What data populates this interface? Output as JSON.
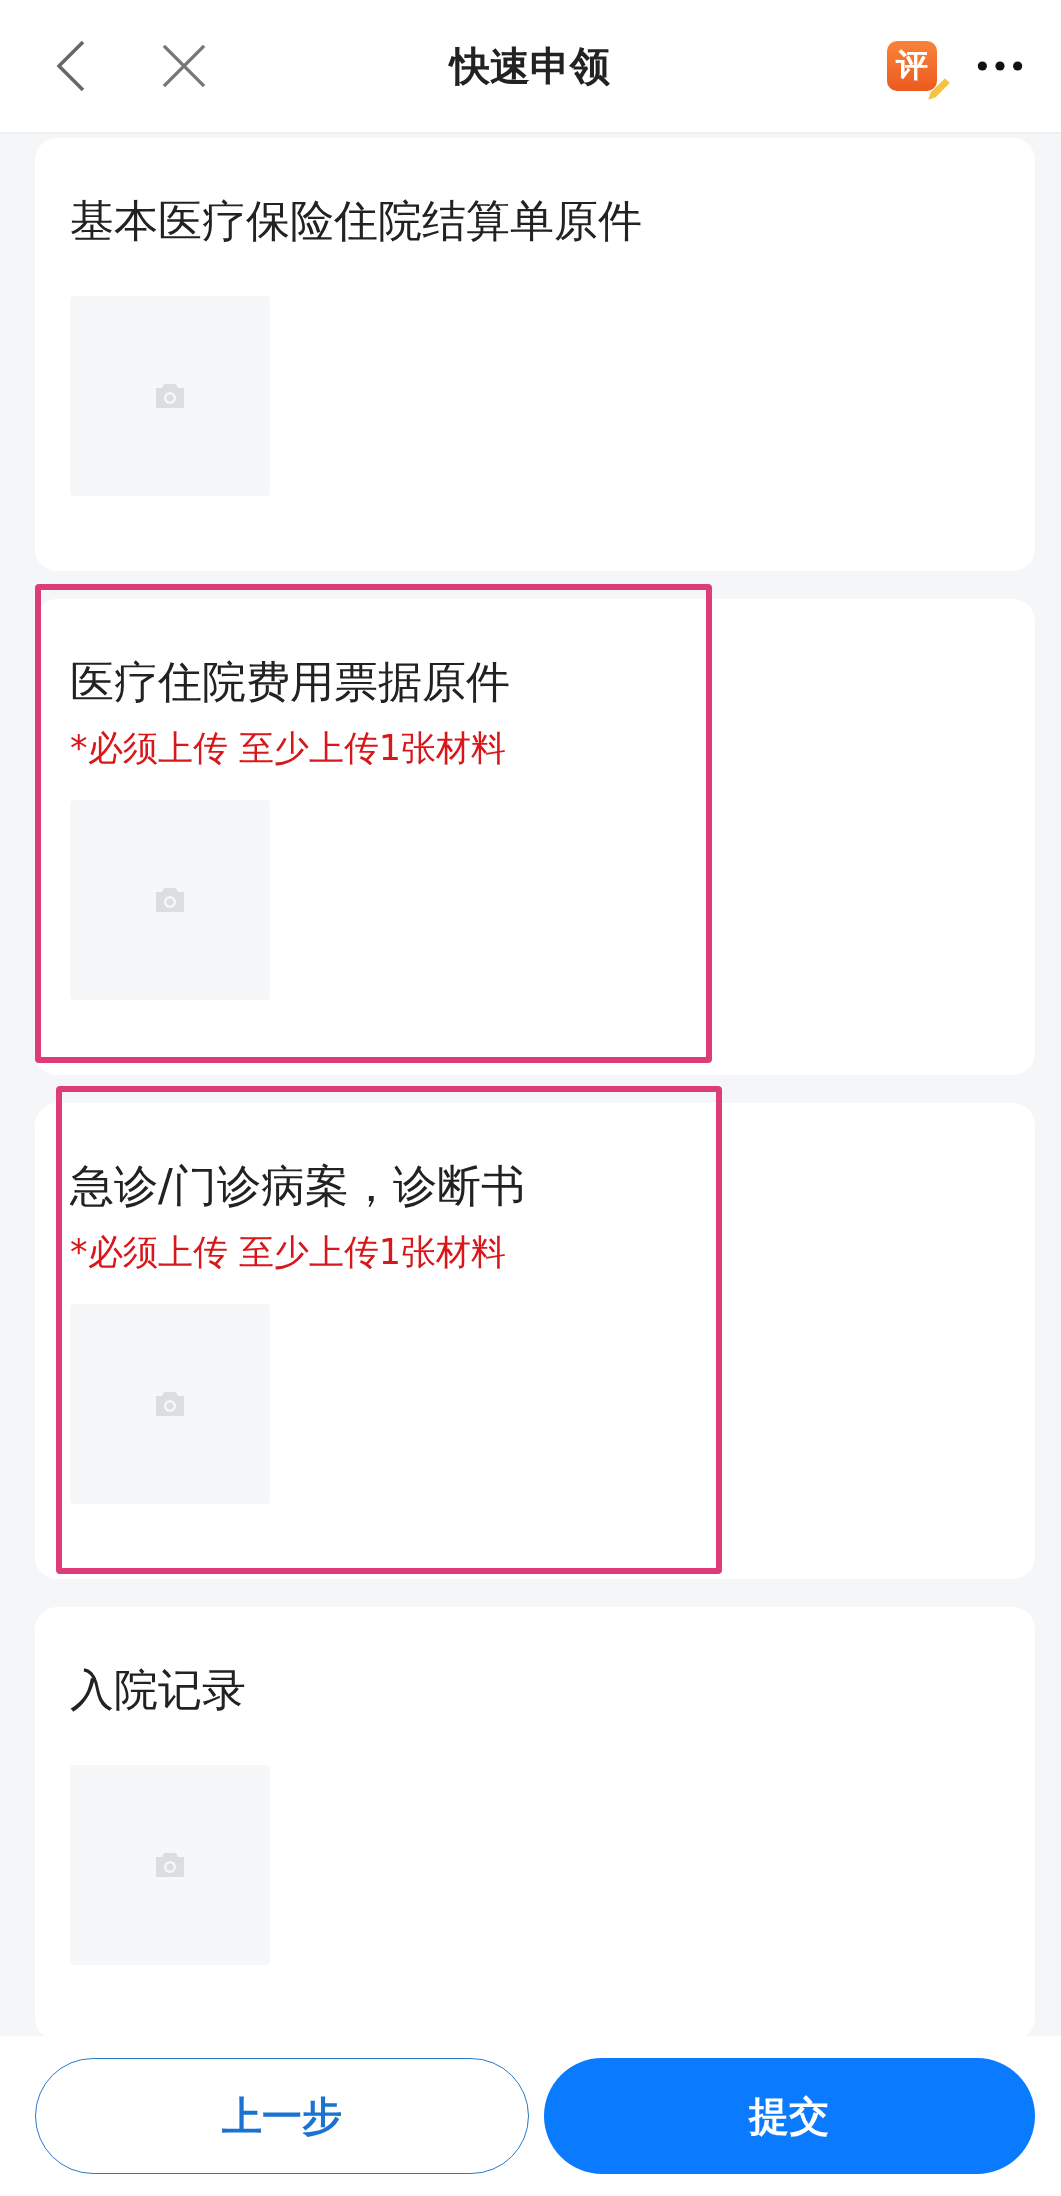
{
  "header": {
    "title": "快速申领",
    "rate_badge": "评"
  },
  "cards": [
    {
      "title": "基本医疗保险住院结算单原件",
      "highlighted": false
    },
    {
      "title": "医疗住院费用票据原件",
      "requirement": "*必须上传 至少上传1张材料",
      "highlighted": true
    },
    {
      "title": "急诊/门诊病案，诊断书",
      "requirement": "*必须上传 至少上传1张材料",
      "highlighted": true
    },
    {
      "title": "入院记录",
      "highlighted": false
    }
  ],
  "footer": {
    "buttons": [
      {
        "label": "上一步",
        "kind": "secondary"
      },
      {
        "label": "提交",
        "kind": "primary"
      }
    ]
  }
}
